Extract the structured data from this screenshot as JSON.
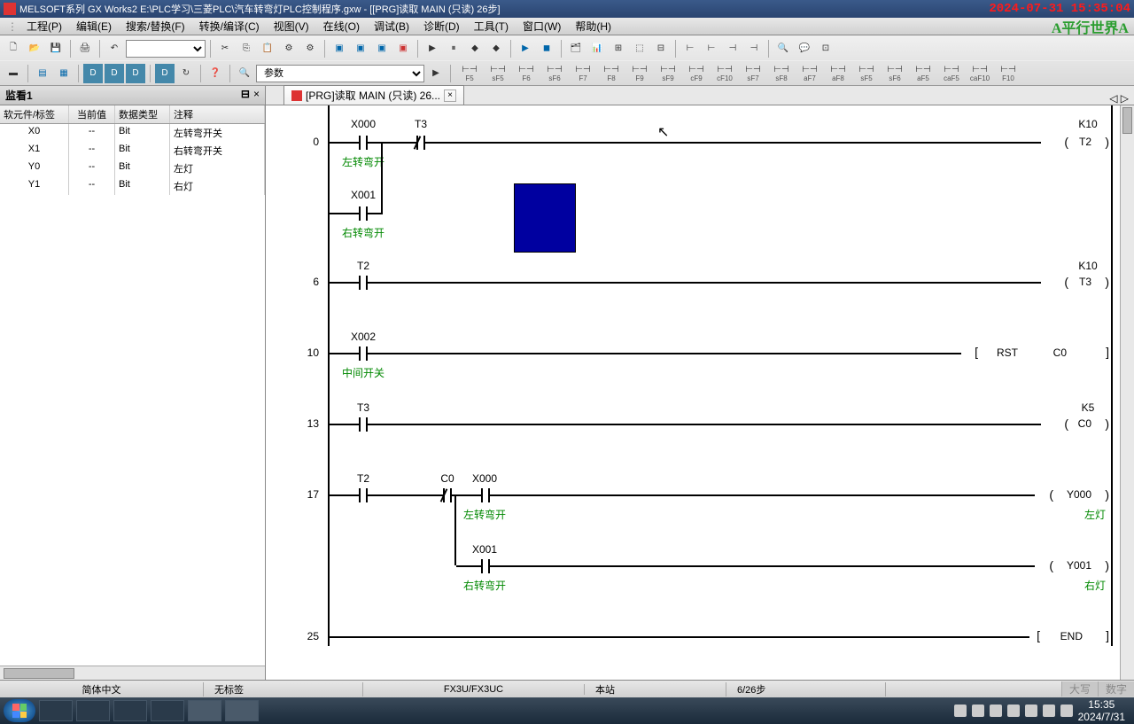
{
  "titlebar": {
    "app": "MELSOFT系列 GX Works2 E:\\PLC学习\\三菱PLC\\汽车转弯灯PLC控制程序.gxw - [[PRG]读取 MAIN (只读) 26步]",
    "date": "2024-07-31 15:35:04"
  },
  "watermark": "A平行世界A",
  "menu": {
    "project": "工程(P)",
    "edit": "编辑(E)",
    "find": "搜索/替换(F)",
    "convert": "转换/编译(C)",
    "view": "视图(V)",
    "online": "在线(O)",
    "debug": "调试(B)",
    "diagnose": "诊断(D)",
    "tool": "工具(T)",
    "window": "窗口(W)",
    "help": "帮助(H)"
  },
  "toolbar": {
    "param_label": "参数",
    "shortcuts": [
      "F5",
      "sF5",
      "F6",
      "sF6",
      "F7",
      "F8",
      "F9",
      "sF9",
      "cF9",
      "cF10",
      "sF7",
      "sF8",
      "aF7",
      "aF8",
      "sF5",
      "sF6",
      "aF5",
      "caF5",
      "caF10",
      "F10"
    ]
  },
  "watch": {
    "title": "监看1",
    "pin": "⊟",
    "close": "×",
    "headers": {
      "c1": "软元件/标签",
      "c2": "当前值",
      "c3": "数据类型",
      "c4": "注释"
    },
    "rows": [
      {
        "dev": "X0",
        "val": "--",
        "type": "Bit",
        "comment": "左转弯开关"
      },
      {
        "dev": "X1",
        "val": "--",
        "type": "Bit",
        "comment": "右转弯开关"
      },
      {
        "dev": "Y0",
        "val": "--",
        "type": "Bit",
        "comment": "左灯"
      },
      {
        "dev": "Y1",
        "val": "--",
        "type": "Bit",
        "comment": "右灯"
      }
    ]
  },
  "tab": {
    "label": "[PRG]读取 MAIN (只读) 26...",
    "close": "×",
    "nav_l": "◁",
    "nav_r": "▷"
  },
  "ladder": {
    "rung0": {
      "step": "0",
      "c1": "X000",
      "c1c": "左转弯开",
      "c2": "T3",
      "k": "K10",
      "out": "T2",
      "c3": "X001",
      "c3c": "右转弯开"
    },
    "rung6": {
      "step": "6",
      "c1": "T2",
      "k": "K10",
      "out": "T3"
    },
    "rung10": {
      "step": "10",
      "c1": "X002",
      "c1c": "中间开关",
      "inst": "RST",
      "op": "C0"
    },
    "rung13": {
      "step": "13",
      "c1": "T3",
      "k": "K5",
      "out": "C0"
    },
    "rung17": {
      "step": "17",
      "c1": "T2",
      "c2": "C0",
      "c3": "X000",
      "c3c": "左转弯开",
      "out1": "Y000",
      "out1c": "左灯",
      "c4": "X001",
      "c4c": "右转弯开",
      "out2": "Y001",
      "out2c": "右灯"
    },
    "rung25": {
      "step": "25",
      "inst": "END"
    }
  },
  "statusbar": {
    "lang": "简体中文",
    "nolabel": "无标签",
    "plc": "FX3U/FX3UC",
    "station": "本站",
    "steps": "6/26步",
    "caps": "大写",
    "num": "数字"
  },
  "taskbar": {
    "time": "15:35",
    "date": "2024/7/31"
  }
}
